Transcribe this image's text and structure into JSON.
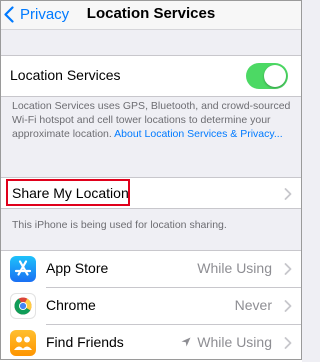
{
  "nav": {
    "back_label": "Privacy",
    "title": "Location Services"
  },
  "location_services": {
    "label": "Location Services",
    "enabled": true,
    "footer_text": "Location Services uses GPS, Bluetooth, and crowd-sourced Wi-Fi hotspot and cell tower locations to determine your approximate location. ",
    "footer_link": "About Location Services & Privacy..."
  },
  "share_my_location": {
    "label": "Share My Location",
    "footer": "This iPhone is being used for location sharing."
  },
  "apps": [
    {
      "name": "App Store",
      "status": "While Using",
      "icon": "app-store-icon",
      "location_arrow": false
    },
    {
      "name": "Chrome",
      "status": "Never",
      "icon": "chrome-icon",
      "location_arrow": false
    },
    {
      "name": "Find Friends",
      "status": "While Using",
      "icon": "find-friends-icon",
      "location_arrow": true
    }
  ],
  "colors": {
    "accent": "#007aff",
    "toggle_on": "#4cd964",
    "highlight": "#e0001b"
  }
}
